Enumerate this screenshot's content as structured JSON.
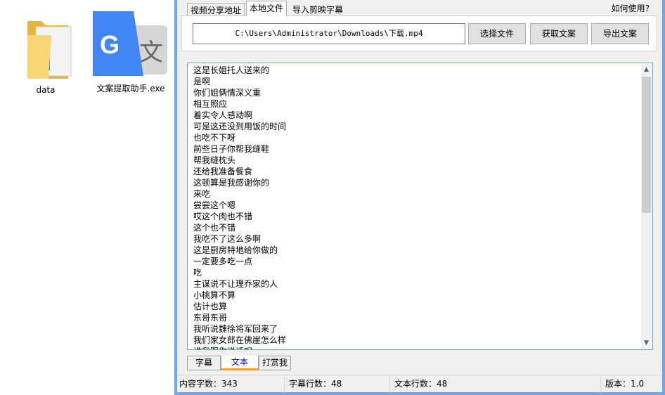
{
  "desktop": {
    "icons": [
      {
        "label": "data"
      },
      {
        "label": "文案提取助手.exe"
      }
    ]
  },
  "window": {
    "top_tabs": [
      {
        "label": "视频分享地址"
      },
      {
        "label": "本地文件"
      },
      {
        "label": "导入剪映字幕"
      }
    ],
    "help_link": "如何使用?",
    "file_path": "C:\\Users\\Administrator\\Downloads\\下载.mp4",
    "buttons": {
      "select": "选择文件",
      "fetch": "获取文案",
      "export": "导出文案"
    },
    "lines": [
      "这是长姐托人送来的",
      "是啊",
      "你们姐俩情深义重",
      "相互照应",
      "着实令人感动啊",
      "可是这还没到用饭的时间",
      "也吃不下呀",
      "前些日子你帮我缝鞋",
      "帮我缝枕头",
      "还给我准备餐食",
      "这顿算是我感谢你的",
      "来吃",
      "尝尝这个嗯",
      "哎这个肉也不错",
      "这个也不错",
      "我吃不了这么多啊",
      "这是厨房特地给你做的",
      "一定要多吃一点",
      "吃",
      "主谋说不让理乔家的人",
      "小桃算不算",
      "估计也算",
      "东哥东哥",
      "我听说魏徐将军回来了",
      "我们家女郎在佛崖怎么样",
      "谁我跟你说话呢"
    ],
    "bottom_tabs": [
      {
        "label": "字幕"
      },
      {
        "label": "文本"
      },
      {
        "label": "打赏我"
      }
    ],
    "status": {
      "content_chars": "内容字数：343",
      "subtitle_lines": "字幕行数：48",
      "text_lines": "文本行数：48",
      "version": "版本：1.0"
    }
  }
}
